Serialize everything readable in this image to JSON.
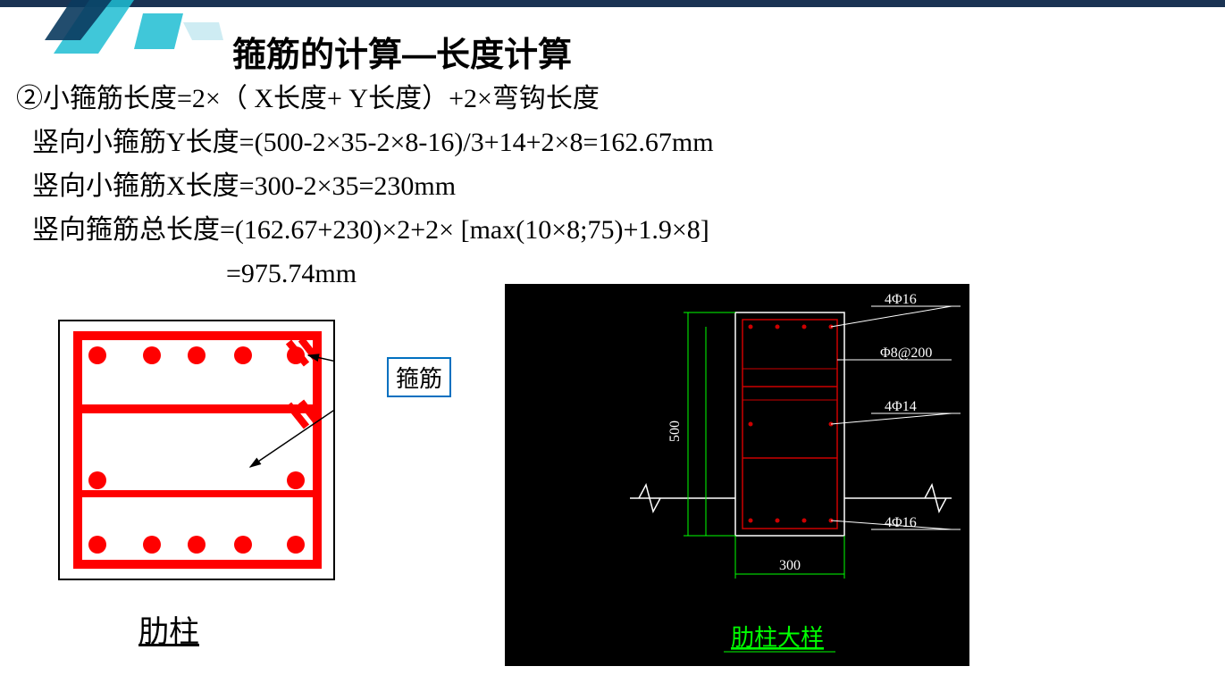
{
  "title": "箍筋的计算—长度计算",
  "lines": {
    "l1": "②小箍筋长度=2×（ X长度+ Y长度）+2×弯钩长度",
    "l2": "竖向小箍筋Y长度=(500-2×35-2×8-16)/3+14+2×8=162.67mm",
    "l3": "竖向小箍筋X长度=300-2×35=230mm",
    "l4": "竖向箍筋总长度=(162.67+230)×2+2× [max(10×8;75)+1.9×8]",
    "l5": "=975.74mm"
  },
  "stirrup_label": "箍筋",
  "left_caption": "肋柱",
  "right_diagram": {
    "dim_h": "500",
    "dim_w": "300",
    "label1": "4Φ16",
    "label2": "Φ8@200",
    "label3": "4Φ14",
    "label4": "4Φ16",
    "caption": "肋柱大样"
  }
}
